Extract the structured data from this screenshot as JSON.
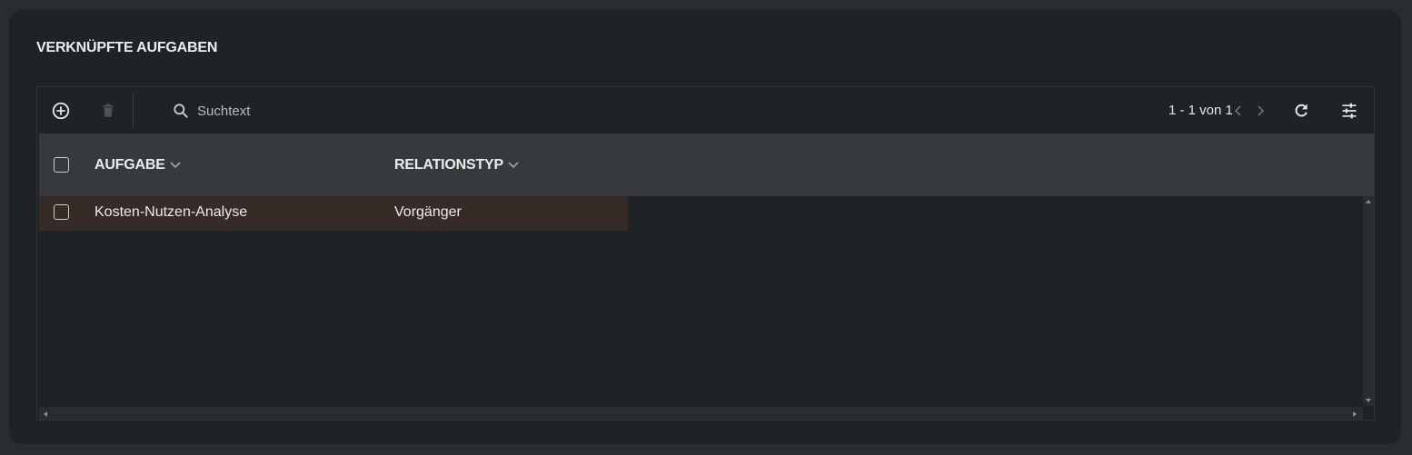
{
  "section": {
    "title": "VERKNÜPFTE AUFGABEN"
  },
  "toolbar": {
    "add_icon": "plus-circle-icon",
    "delete_icon": "trash-icon",
    "search_icon": "search-icon",
    "search_placeholder": "Suchtext",
    "search_value": "",
    "pager_text": "1 - 1 von 1",
    "prev_icon": "chevron-left-icon",
    "next_icon": "chevron-right-icon",
    "refresh_icon": "refresh-icon",
    "settings_icon": "tune-icon"
  },
  "table": {
    "columns": [
      {
        "label": "AUFGABE",
        "sort_icon": "chevron-down-icon"
      },
      {
        "label": "RELATIONSTYP",
        "sort_icon": "chevron-down-icon"
      }
    ],
    "rows": [
      {
        "aufgabe": "Kosten-Nutzen-Analyse",
        "relationstyp": "Vorgänger",
        "selected": false
      }
    ]
  },
  "colors": {
    "background": "#2a2d30",
    "card": "#202326",
    "header": "#363a3d",
    "row_highlight": "#362b27",
    "text": "#ececec"
  }
}
